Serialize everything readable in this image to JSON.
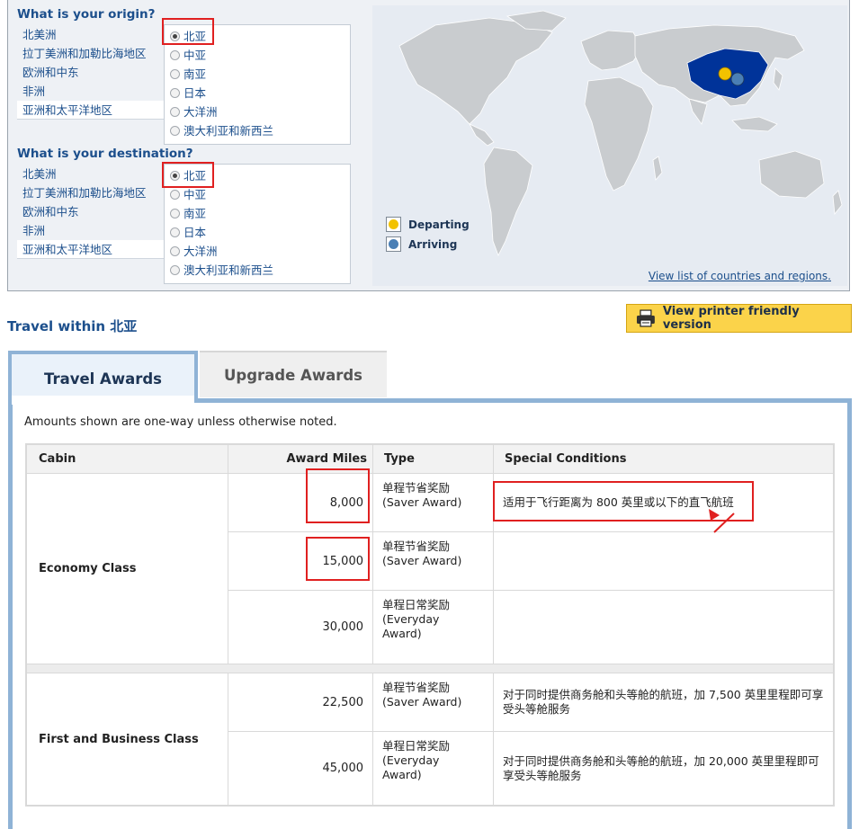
{
  "origin": {
    "title": "What is your origin?",
    "regions": [
      "北美洲",
      "拉丁美洲和加勒比海地区",
      "欧洲和中东",
      "非洲",
      "亚洲和太平洋地区"
    ],
    "subregions": [
      "北亚",
      "中亚",
      "南亚",
      "日本",
      "大洋洲",
      "澳大利亚和新西兰"
    ],
    "selected": "北亚"
  },
  "destination": {
    "title": "What is your destination?",
    "regions": [
      "北美洲",
      "拉丁美洲和加勒比海地区",
      "欧洲和中东",
      "非洲",
      "亚洲和太平洋地区"
    ],
    "subregions": [
      "北亚",
      "中亚",
      "南亚",
      "日本",
      "大洋洲",
      "澳大利亚和新西兰"
    ],
    "selected": "北亚"
  },
  "map": {
    "legend_departing": "Departing",
    "legend_arriving": "Arriving",
    "view_link": "View list of countries and regions",
    "view_link_suffix": ".",
    "colors": {
      "ocean": "#e6ebf2",
      "land": "#c9cccf",
      "highlight": "#003399",
      "departing": "#f2c200",
      "arriving": "#4a7fb5"
    }
  },
  "travel_within": "Travel within 北亚",
  "printer_button": "View printer friendly version",
  "tabs": {
    "active": "Travel Awards",
    "inactive": "Upgrade Awards"
  },
  "note": "Amounts shown are one-way unless otherwise noted.",
  "table": {
    "headers": {
      "cabin": "Cabin",
      "miles": "Award Miles",
      "type": "Type",
      "conditions": "Special Conditions"
    },
    "groups": [
      {
        "cabin": "Economy Class",
        "rows": [
          {
            "miles": "8,000",
            "type_cn": "单程节省奖励",
            "type_en": "(Saver Award)",
            "condition": "适用于飞行距离为 800 英里或以下的直飞航班"
          },
          {
            "miles": "15,000",
            "type_cn": "单程节省奖励",
            "type_en": "(Saver Award)",
            "condition": ""
          },
          {
            "miles": "30,000",
            "type_cn": "单程日常奖励",
            "type_en": "(Everyday Award)",
            "condition": ""
          }
        ]
      },
      {
        "cabin": "First and Business Class",
        "rows": [
          {
            "miles": "22,500",
            "type_cn": "单程节省奖励",
            "type_en": "(Saver Award)",
            "condition": "对于同时提供商务舱和头等舱的航班，加 7,500 英里里程即可享受头等舱服务"
          },
          {
            "miles": "45,000",
            "type_cn": "单程日常奖励",
            "type_en": "(Everyday Award)",
            "condition": "对于同时提供商务舱和头等舱的航班，加 20,000 英里里程即可享受头等舱服务"
          }
        ]
      }
    ]
  }
}
